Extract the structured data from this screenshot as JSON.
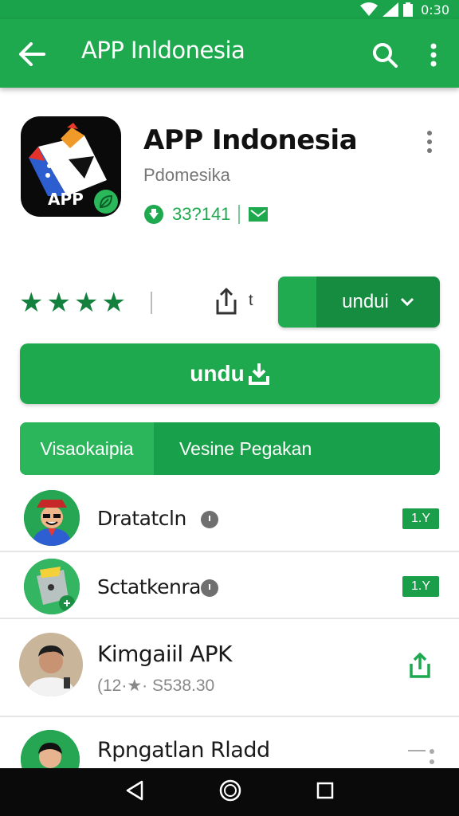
{
  "status_bar": {
    "time": "0:30"
  },
  "app_bar": {
    "title": "APP Inldonesia"
  },
  "app": {
    "icon_label": "APP",
    "name": "APP Indonesia",
    "developer": "Pdomesika",
    "downloads": "33?141"
  },
  "actions": {
    "rating_stars": 4,
    "share_label": "t",
    "split_button_label": "undui",
    "download_label": "undu"
  },
  "tabs": [
    {
      "label": "Visaokaipia"
    },
    {
      "label": "Vesine Pegakan"
    }
  ],
  "list": [
    {
      "name": "Dratatcln",
      "badge": "1.Y"
    },
    {
      "name": "Sctatkenra",
      "badge": "1.Y"
    },
    {
      "name": "Kimgaiil APK",
      "subtitle": "(12·★· S538.30"
    },
    {
      "name": "Rpngatlan Rladd"
    }
  ],
  "colors": {
    "primary_green": "#1fa94f",
    "dark_green": "#168c40",
    "status_green": "#1aa34a"
  }
}
